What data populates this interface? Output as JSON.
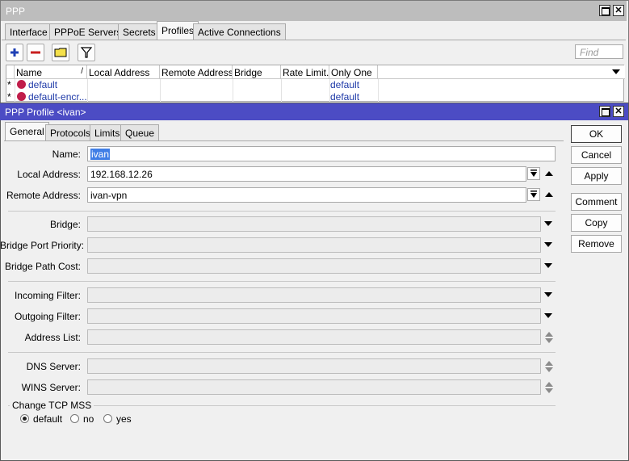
{
  "outer": {
    "title": "PPP",
    "tabs": [
      "Interface",
      "PPPoE Servers",
      "Secrets",
      "Profiles",
      "Active Connections"
    ],
    "active_tab": "Profiles",
    "find_placeholder": "Find",
    "columns": [
      "Name",
      "/",
      "Local Address",
      "Remote Address",
      "Bridge",
      "Rate Limit...",
      "Only One"
    ],
    "rows": [
      {
        "flag": "*",
        "name": "default",
        "only_one": "default"
      },
      {
        "flag": "*",
        "name": "default-encr...",
        "only_one": "default"
      }
    ]
  },
  "inner": {
    "title": "PPP Profile <ivan>",
    "tabs": [
      "General",
      "Protocols",
      "Limits",
      "Queue"
    ],
    "active_tab": "General",
    "labels": {
      "name": "Name:",
      "local_address": "Local Address:",
      "remote_address": "Remote Address:",
      "bridge": "Bridge:",
      "bridge_port_priority": "Bridge Port Priority:",
      "bridge_path_cost": "Bridge Path Cost:",
      "incoming_filter": "Incoming Filter:",
      "outgoing_filter": "Outgoing Filter:",
      "address_list": "Address List:",
      "dns_server": "DNS Server:",
      "wins_server": "WINS Server:"
    },
    "values": {
      "name": "ivan",
      "local_address": "192.168.12.26",
      "remote_address": "ivan-vpn"
    },
    "tcp_mss": {
      "legend": "Change TCP MSS",
      "options": [
        "default",
        "no",
        "yes"
      ],
      "selected": "default"
    },
    "buttons": [
      "OK",
      "Cancel",
      "Apply",
      "Comment",
      "Copy",
      "Remove"
    ]
  },
  "colors": {
    "active_title": "#4c4cc4",
    "inactive_title": "#bdbdbd",
    "link_text": "#1f3aa8",
    "selection": "#3f7ee6"
  }
}
